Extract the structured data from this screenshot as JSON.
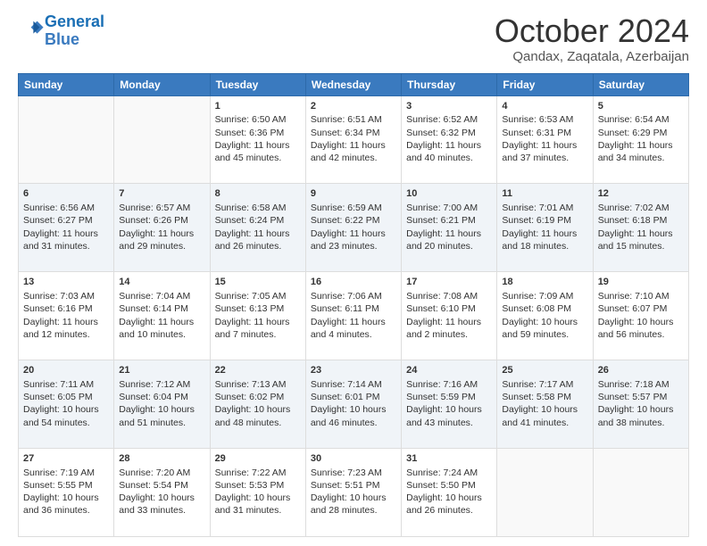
{
  "logo": {
    "line1": "General",
    "line2": "Blue"
  },
  "title": "October 2024",
  "subtitle": "Qandax, Zaqatala, Azerbaijan",
  "days_of_week": [
    "Sunday",
    "Monday",
    "Tuesday",
    "Wednesday",
    "Thursday",
    "Friday",
    "Saturday"
  ],
  "weeks": [
    [
      {
        "day": "",
        "sunrise": "",
        "sunset": "",
        "daylight": ""
      },
      {
        "day": "",
        "sunrise": "",
        "sunset": "",
        "daylight": ""
      },
      {
        "day": "1",
        "sunrise": "Sunrise: 6:50 AM",
        "sunset": "Sunset: 6:36 PM",
        "daylight": "Daylight: 11 hours and 45 minutes."
      },
      {
        "day": "2",
        "sunrise": "Sunrise: 6:51 AM",
        "sunset": "Sunset: 6:34 PM",
        "daylight": "Daylight: 11 hours and 42 minutes."
      },
      {
        "day": "3",
        "sunrise": "Sunrise: 6:52 AM",
        "sunset": "Sunset: 6:32 PM",
        "daylight": "Daylight: 11 hours and 40 minutes."
      },
      {
        "day": "4",
        "sunrise": "Sunrise: 6:53 AM",
        "sunset": "Sunset: 6:31 PM",
        "daylight": "Daylight: 11 hours and 37 minutes."
      },
      {
        "day": "5",
        "sunrise": "Sunrise: 6:54 AM",
        "sunset": "Sunset: 6:29 PM",
        "daylight": "Daylight: 11 hours and 34 minutes."
      }
    ],
    [
      {
        "day": "6",
        "sunrise": "Sunrise: 6:56 AM",
        "sunset": "Sunset: 6:27 PM",
        "daylight": "Daylight: 11 hours and 31 minutes."
      },
      {
        "day": "7",
        "sunrise": "Sunrise: 6:57 AM",
        "sunset": "Sunset: 6:26 PM",
        "daylight": "Daylight: 11 hours and 29 minutes."
      },
      {
        "day": "8",
        "sunrise": "Sunrise: 6:58 AM",
        "sunset": "Sunset: 6:24 PM",
        "daylight": "Daylight: 11 hours and 26 minutes."
      },
      {
        "day": "9",
        "sunrise": "Sunrise: 6:59 AM",
        "sunset": "Sunset: 6:22 PM",
        "daylight": "Daylight: 11 hours and 23 minutes."
      },
      {
        "day": "10",
        "sunrise": "Sunrise: 7:00 AM",
        "sunset": "Sunset: 6:21 PM",
        "daylight": "Daylight: 11 hours and 20 minutes."
      },
      {
        "day": "11",
        "sunrise": "Sunrise: 7:01 AM",
        "sunset": "Sunset: 6:19 PM",
        "daylight": "Daylight: 11 hours and 18 minutes."
      },
      {
        "day": "12",
        "sunrise": "Sunrise: 7:02 AM",
        "sunset": "Sunset: 6:18 PM",
        "daylight": "Daylight: 11 hours and 15 minutes."
      }
    ],
    [
      {
        "day": "13",
        "sunrise": "Sunrise: 7:03 AM",
        "sunset": "Sunset: 6:16 PM",
        "daylight": "Daylight: 11 hours and 12 minutes."
      },
      {
        "day": "14",
        "sunrise": "Sunrise: 7:04 AM",
        "sunset": "Sunset: 6:14 PM",
        "daylight": "Daylight: 11 hours and 10 minutes."
      },
      {
        "day": "15",
        "sunrise": "Sunrise: 7:05 AM",
        "sunset": "Sunset: 6:13 PM",
        "daylight": "Daylight: 11 hours and 7 minutes."
      },
      {
        "day": "16",
        "sunrise": "Sunrise: 7:06 AM",
        "sunset": "Sunset: 6:11 PM",
        "daylight": "Daylight: 11 hours and 4 minutes."
      },
      {
        "day": "17",
        "sunrise": "Sunrise: 7:08 AM",
        "sunset": "Sunset: 6:10 PM",
        "daylight": "Daylight: 11 hours and 2 minutes."
      },
      {
        "day": "18",
        "sunrise": "Sunrise: 7:09 AM",
        "sunset": "Sunset: 6:08 PM",
        "daylight": "Daylight: 10 hours and 59 minutes."
      },
      {
        "day": "19",
        "sunrise": "Sunrise: 7:10 AM",
        "sunset": "Sunset: 6:07 PM",
        "daylight": "Daylight: 10 hours and 56 minutes."
      }
    ],
    [
      {
        "day": "20",
        "sunrise": "Sunrise: 7:11 AM",
        "sunset": "Sunset: 6:05 PM",
        "daylight": "Daylight: 10 hours and 54 minutes."
      },
      {
        "day": "21",
        "sunrise": "Sunrise: 7:12 AM",
        "sunset": "Sunset: 6:04 PM",
        "daylight": "Daylight: 10 hours and 51 minutes."
      },
      {
        "day": "22",
        "sunrise": "Sunrise: 7:13 AM",
        "sunset": "Sunset: 6:02 PM",
        "daylight": "Daylight: 10 hours and 48 minutes."
      },
      {
        "day": "23",
        "sunrise": "Sunrise: 7:14 AM",
        "sunset": "Sunset: 6:01 PM",
        "daylight": "Daylight: 10 hours and 46 minutes."
      },
      {
        "day": "24",
        "sunrise": "Sunrise: 7:16 AM",
        "sunset": "Sunset: 5:59 PM",
        "daylight": "Daylight: 10 hours and 43 minutes."
      },
      {
        "day": "25",
        "sunrise": "Sunrise: 7:17 AM",
        "sunset": "Sunset: 5:58 PM",
        "daylight": "Daylight: 10 hours and 41 minutes."
      },
      {
        "day": "26",
        "sunrise": "Sunrise: 7:18 AM",
        "sunset": "Sunset: 5:57 PM",
        "daylight": "Daylight: 10 hours and 38 minutes."
      }
    ],
    [
      {
        "day": "27",
        "sunrise": "Sunrise: 7:19 AM",
        "sunset": "Sunset: 5:55 PM",
        "daylight": "Daylight: 10 hours and 36 minutes."
      },
      {
        "day": "28",
        "sunrise": "Sunrise: 7:20 AM",
        "sunset": "Sunset: 5:54 PM",
        "daylight": "Daylight: 10 hours and 33 minutes."
      },
      {
        "day": "29",
        "sunrise": "Sunrise: 7:22 AM",
        "sunset": "Sunset: 5:53 PM",
        "daylight": "Daylight: 10 hours and 31 minutes."
      },
      {
        "day": "30",
        "sunrise": "Sunrise: 7:23 AM",
        "sunset": "Sunset: 5:51 PM",
        "daylight": "Daylight: 10 hours and 28 minutes."
      },
      {
        "day": "31",
        "sunrise": "Sunrise: 7:24 AM",
        "sunset": "Sunset: 5:50 PM",
        "daylight": "Daylight: 10 hours and 26 minutes."
      },
      {
        "day": "",
        "sunrise": "",
        "sunset": "",
        "daylight": ""
      },
      {
        "day": "",
        "sunrise": "",
        "sunset": "",
        "daylight": ""
      }
    ]
  ]
}
